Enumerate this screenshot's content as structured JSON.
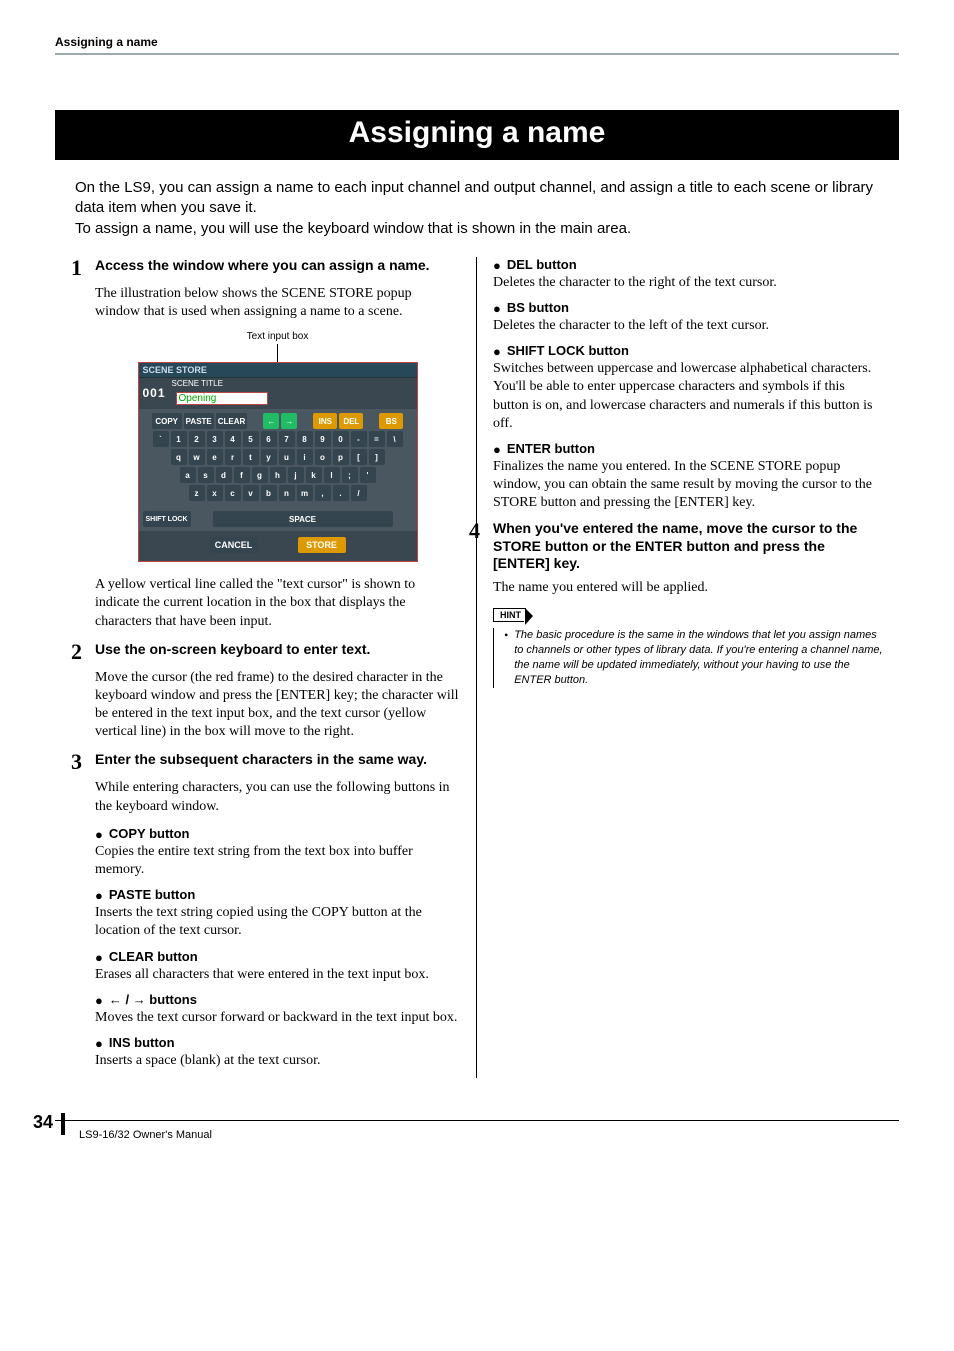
{
  "runningHead": "Assigning a name",
  "title": "Assigning a name",
  "intro1": "On the LS9, you can assign a name to each input channel and output channel, and assign a title to each scene or library data item when you save it.",
  "intro2": "To assign a name, you will use the keyboard window that is shown in the main area.",
  "steps": {
    "s1": {
      "num": "1",
      "head": "Access the window where you can assign a name.",
      "body": "The illustration below shows the SCENE STORE popup window that is used when assigning a name to a scene."
    },
    "s2": {
      "num": "2",
      "head": "Use the on-screen keyboard to enter text.",
      "body": "Move the cursor (the red frame) to the desired character in the keyboard window and press the [ENTER] key; the character will be entered in the text input box, and the text cursor (yellow vertical line) in the box will move to the right."
    },
    "s3": {
      "num": "3",
      "head": "Enter the subsequent characters in the same way.",
      "body": "While entering characters, you can use the following buttons in the keyboard window."
    },
    "s4": {
      "num": "4",
      "head": "When you've entered the name, move the cursor to the STORE button or the ENTER button and press the [ENTER] key.",
      "body": "The name you entered will be applied."
    }
  },
  "s1after": "A yellow vertical line called the \"text cursor\" is shown to indicate the current location in the box that displays the characters that have been input.",
  "callout": "Text input box",
  "kbd": {
    "topLabel": "SCENE STORE",
    "num": "001",
    "titleLabel": "SCENE TITLE",
    "inputValue": "Opening",
    "copy": "COPY",
    "paste": "PASTE",
    "clear": "CLEAR",
    "ins": "INS",
    "del": "DEL",
    "bs": "BS",
    "shift": "SHIFT LOCK",
    "space": "SPACE",
    "cancel": "CANCEL",
    "store": "STORE",
    "row1": [
      "`",
      "1",
      "2",
      "3",
      "4",
      "5",
      "6",
      "7",
      "8",
      "9",
      "0",
      "-",
      "=",
      "\\"
    ],
    "row2": [
      "q",
      "w",
      "e",
      "r",
      "t",
      "y",
      "u",
      "i",
      "o",
      "p",
      "[",
      "]"
    ],
    "row3": [
      "a",
      "s",
      "d",
      "f",
      "g",
      "h",
      "j",
      "k",
      "l",
      ";",
      "'"
    ],
    "row4": [
      "z",
      "x",
      "c",
      "v",
      "b",
      "n",
      "m",
      ",",
      ".",
      "/"
    ]
  },
  "buttons": {
    "copy": {
      "head": "COPY button",
      "body": "Copies the entire text string from the text box into buffer memory."
    },
    "paste": {
      "head": "PASTE button",
      "body": "Inserts the text string copied using the COPY button at the location of the text cursor."
    },
    "clear": {
      "head": "CLEAR button",
      "body": "Erases all characters that were entered in the text input box."
    },
    "arrows": {
      "head": "← / → buttons",
      "body": "Moves the text cursor forward or backward in the text input box."
    },
    "ins": {
      "head": "INS button",
      "body": "Inserts a space (blank) at the text cursor."
    },
    "del": {
      "head": "DEL button",
      "body": "Deletes the character to the right of the text cursor."
    },
    "bsbtn": {
      "head": "BS button",
      "body": "Deletes the character to the left of the text cursor."
    },
    "shift": {
      "head": "SHIFT LOCK button",
      "body": "Switches between uppercase and lowercase alphabetical characters. You'll be able to enter uppercase characters and symbols if this button is on, and lowercase characters and numerals if this button is off."
    },
    "enter": {
      "head": "ENTER button",
      "body": "Finalizes the name you entered. In the SCENE STORE popup window, you can obtain the same result by moving the cursor to the STORE button and pressing the [ENTER] key."
    }
  },
  "hint": {
    "label": "HINT",
    "text": "The basic procedure is the same in the windows that let you assign names to channels or other types of library data. If you're entering a channel name, the name will be updated immediately, without your having to use the ENTER button."
  },
  "footer": {
    "pageNum": "34",
    "doc": "LS9-16/32  Owner's Manual"
  }
}
